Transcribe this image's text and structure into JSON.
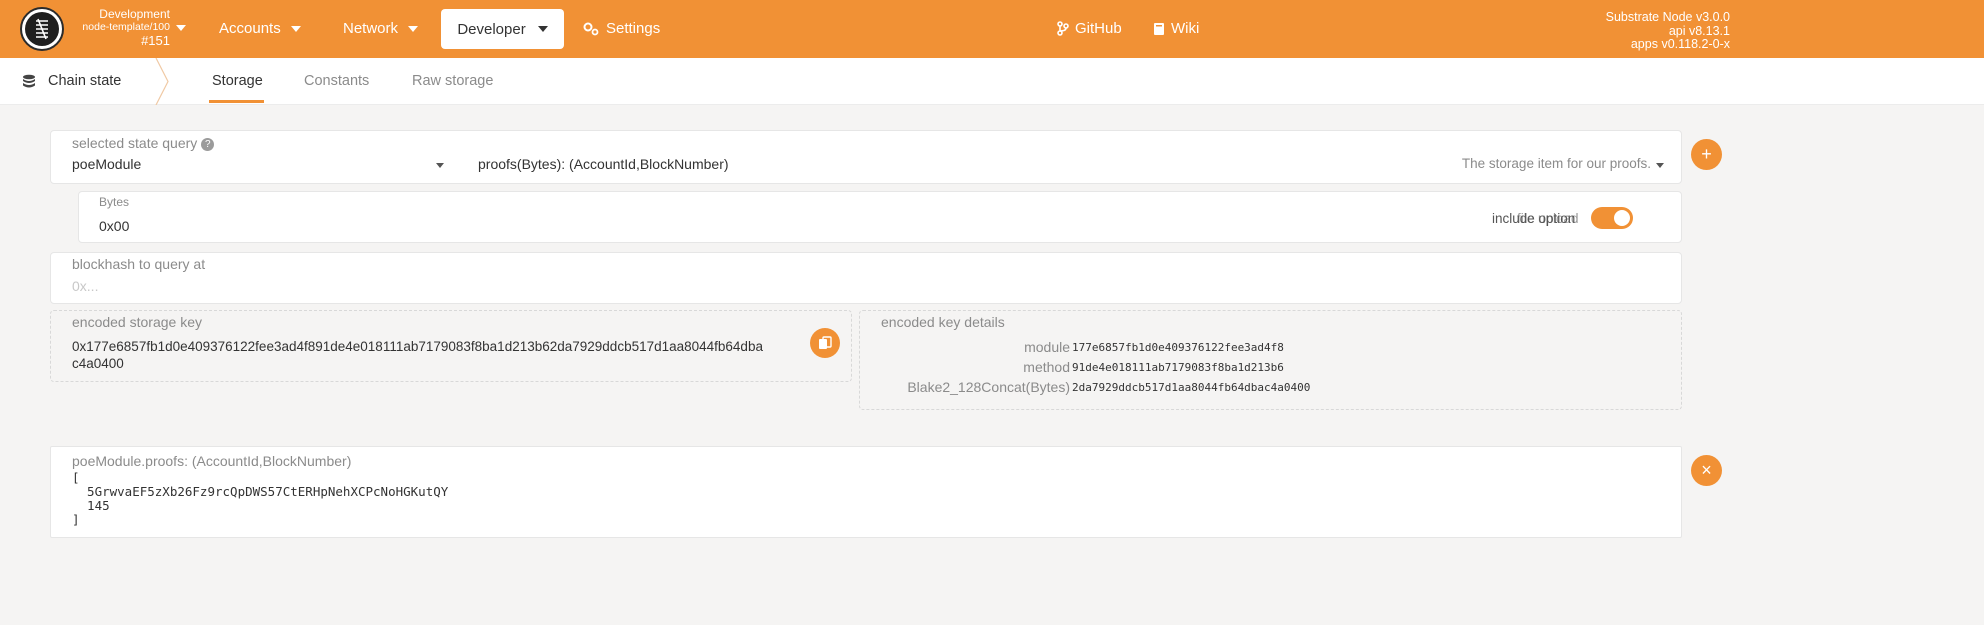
{
  "header": {
    "chain_name": "Development",
    "node_name": "node-template/100",
    "block_number": "#151",
    "menu": {
      "accounts": "Accounts",
      "network": "Network",
      "developer": "Developer",
      "settings": "Settings",
      "github": "GitHub",
      "wiki": "Wiki"
    },
    "version": {
      "node": "Substrate Node v3.0.0",
      "api": "api v8.13.1",
      "apps": "apps v0.118.2-0-x"
    }
  },
  "subnav": {
    "title": "Chain state",
    "tabs": [
      "Storage",
      "Constants",
      "Raw storage"
    ]
  },
  "query": {
    "selected_label": "selected state query",
    "help_glyph": "?",
    "module": "poeModule",
    "method": "proofs(Bytes): (AccountId,BlockNumber)",
    "method_description": "The storage item for our proofs.",
    "param_label": "Bytes",
    "param_value": "0x00",
    "toggle_label": "include option",
    "toggle_label_overlay": "file upload",
    "blockhash_label": "blockhash to query at",
    "blockhash_placeholder": "0x..."
  },
  "encoded": {
    "key_label": "encoded storage key",
    "key_line1": "0x177e6857fb1d0e409376122fee3ad4f891de4e018111ab7179083f8ba1d213b62da7929ddcb517d1aa8044fb64dba",
    "key_line2": "c4a0400",
    "details_label": "encoded key details",
    "rows": [
      {
        "name": "module",
        "value": "177e6857fb1d0e409376122fee3ad4f8"
      },
      {
        "name": "method",
        "value": "91de4e018111ab7179083f8ba1d213b6"
      },
      {
        "name": "Blake2_128Concat(Bytes)",
        "value": "2da7929ddcb517d1aa8044fb64dbac4a0400"
      }
    ]
  },
  "result": {
    "title": "poeModule.proofs: (AccountId,BlockNumber)",
    "lines": [
      "[",
      "  5GrwvaEF5zXb26Fz9rcQpDWS57CtERHpNehXCPcNoHGKutQY",
      "  145",
      "]"
    ]
  },
  "buttons": {
    "add_glyph": "+",
    "close_glyph": "×"
  },
  "colors": {
    "accent": "#f19135",
    "background": "#f5f4f3"
  }
}
